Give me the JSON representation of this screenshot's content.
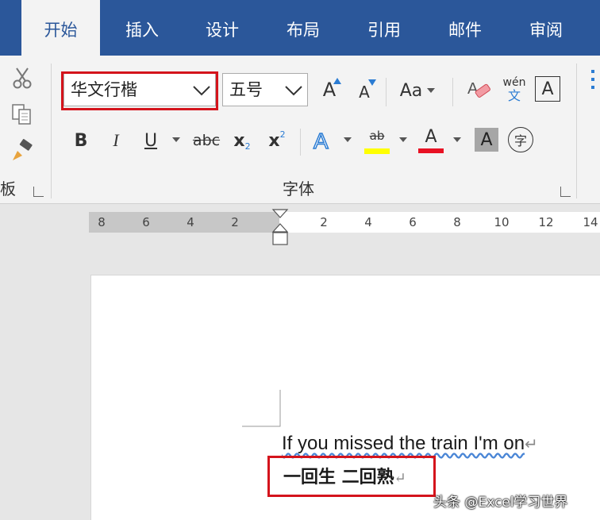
{
  "tabs": [
    {
      "label": "开始",
      "active": true
    },
    {
      "label": "插入"
    },
    {
      "label": "设计"
    },
    {
      "label": "布局"
    },
    {
      "label": "引用"
    },
    {
      "label": "邮件"
    },
    {
      "label": "审阅"
    }
  ],
  "font": {
    "name": "华文行楷",
    "size": "五号",
    "group_label": "字体",
    "change_case_label": "Aa",
    "phonetic_top": "wén",
    "phonetic_bottom": "文",
    "char_border_label": "A",
    "bold": "B",
    "italic": "I",
    "underline": "U",
    "strike": "abc",
    "subscript": "x",
    "subscript_mark": "2",
    "superscript": "x",
    "superscript_mark": "2",
    "highlight_label": "ab",
    "font_color_label": "A",
    "shading_label": "A",
    "enclose_label": "字",
    "grow_label": "A",
    "shrink_label": "A"
  },
  "clipboard": {
    "group_label_fragment": "板"
  },
  "colors": {
    "accent": "#2b579a",
    "highlight": "#ffff00",
    "font_color": "#e81123",
    "annotation": "#d4141c"
  },
  "ruler": {
    "left_ticks": [
      "8",
      "6",
      "4",
      "2"
    ],
    "right_ticks": [
      "2",
      "4",
      "6",
      "8",
      "10",
      "12",
      "14"
    ]
  },
  "document": {
    "line1": "If you missed the train I'm on",
    "line2": "一回生 二回熟",
    "paragraph_mark": "↵"
  },
  "watermark": "头条 @Excel学习世界"
}
